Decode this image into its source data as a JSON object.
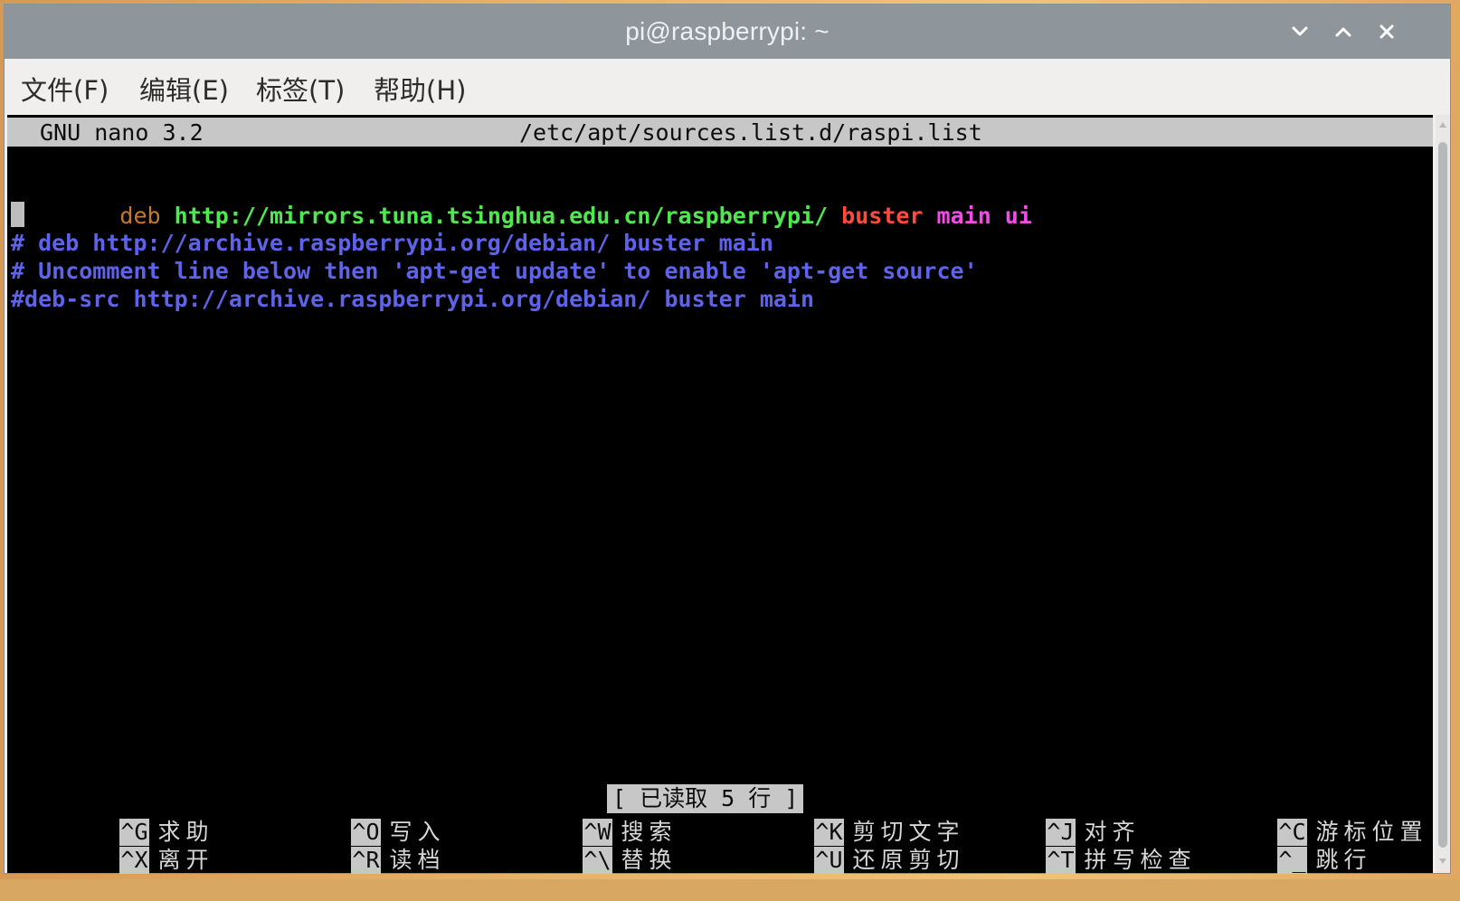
{
  "window": {
    "title": "pi@raspberrypi: ~"
  },
  "menu": {
    "items": [
      "文件(F)",
      "编辑(E)",
      "标签(T)",
      "帮助(H)"
    ]
  },
  "nano": {
    "version": "GNU nano 3.2",
    "filename": "/etc/apt/sources.list.d/raspi.list",
    "lines": [
      {
        "keyword": "deb",
        "url": "http://mirrors.tuna.tsinghua.edu.cn/raspberrypi/",
        "suite": "buster",
        "components": "main ui"
      },
      {
        "text": "# deb http://archive.raspberrypi.org/debian/ buster main"
      },
      {
        "text": "# Uncomment line below then 'apt-get update' to enable 'apt-get source'"
      },
      {
        "text": "#deb-src http://archive.raspberrypi.org/debian/ buster main"
      }
    ],
    "status": "[ 已读取 5 行 ]",
    "shortcuts": [
      {
        "key": "^G",
        "label": "求助"
      },
      {
        "key": "^O",
        "label": "写入"
      },
      {
        "key": "^W",
        "label": "搜索"
      },
      {
        "key": "^K",
        "label": "剪切文字"
      },
      {
        "key": "^J",
        "label": "对齐"
      },
      {
        "key": "^C",
        "label": "游标位置"
      },
      {
        "key": "^X",
        "label": "离开"
      },
      {
        "key": "^R",
        "label": "读档"
      },
      {
        "key": "^\\",
        "label": "替换"
      },
      {
        "key": "^U",
        "label": "还原剪切"
      },
      {
        "key": "^T",
        "label": "拼写检查"
      },
      {
        "key": "^_",
        "label": "跳行"
      }
    ]
  },
  "colors": {
    "titlebar": "#8e969b",
    "terminal_bg": "#000000",
    "syntax_keyword": "#c8782e",
    "syntax_url": "#4fe84f",
    "syntax_suite": "#ff4a3c",
    "syntax_components": "#f24ce8",
    "syntax_comment": "#5e63ea"
  },
  "icons": {
    "minimize": "chevron-down-icon",
    "maximize": "chevron-up-icon",
    "close": "close-icon"
  }
}
